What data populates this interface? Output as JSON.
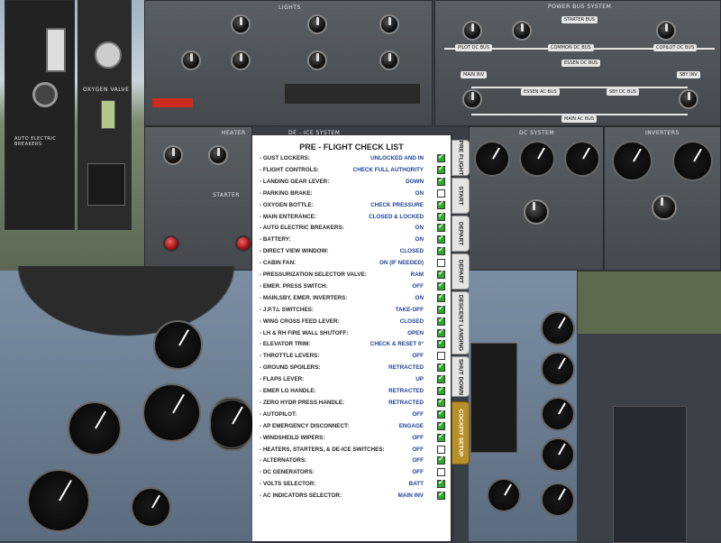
{
  "panels": {
    "lights": "LIGHTS",
    "power_bus": "POWER BUS SYSTEM",
    "heater": "HEATER",
    "deice": "DE - ICE SYSTEM",
    "dc_system": "DC SYSTEM",
    "inverters": "INVERTERS",
    "starter": "STARTER",
    "auto_breakers": "AUTO ELECTRIC BREAKERS",
    "oxygen": "OXYGEN VALVE"
  },
  "bus_labels": [
    "PILOT DC BUS",
    "COMMON DC BUS",
    "COPILOT DC BUS",
    "STARTER BUS",
    "ESSEN DC BUS",
    "MAIN INV",
    "SBY INV",
    "ESSEN AC BUS",
    "SBY DC BUS",
    "MAIN AC BUS"
  ],
  "checklist": {
    "title": "PRE - FLIGHT CHECK LIST",
    "items": [
      {
        "label": "- GUST LOCKERS:",
        "value": "UNLOCKED AND IN",
        "checked": true
      },
      {
        "label": "- FLIGHT CONTROLS:",
        "value": "CHECK FULL AUTHORITY",
        "checked": true
      },
      {
        "label": "- LANDING GEAR LEVER:",
        "value": "DOWN",
        "checked": true
      },
      {
        "label": "- PARKING BRAKE:",
        "value": "ON",
        "checked": false
      },
      {
        "label": "- OXYGEN BOTTLE:",
        "value": "CHECK PRESSURE",
        "checked": true
      },
      {
        "label": "- MAIN ENTERANCE:",
        "value": "CLOSED & LOCKED",
        "checked": true
      },
      {
        "label": "- AUTO ELECTRIC BREAKERS:",
        "value": "ON",
        "checked": true
      },
      {
        "label": "- BATTERY:",
        "value": "ON",
        "checked": true
      },
      {
        "label": "- DIRECT VIEW WINDOW:",
        "value": "CLOSED",
        "checked": true
      },
      {
        "label": "- CABIN FAN:",
        "value": "ON (IF NEEDED)",
        "checked": false
      },
      {
        "label": "- PRESSURIZATION SELECTOR VALVE:",
        "value": "RAM",
        "checked": true
      },
      {
        "label": "- EMER. PRESS SWITCH:",
        "value": "OFF",
        "checked": true
      },
      {
        "label": "- MAIN,SBY, EMER. INVERTERS:",
        "value": "ON",
        "checked": true
      },
      {
        "label": "- J.P.T.L SWITCHES:",
        "value": "TAKE-OFF",
        "checked": true
      },
      {
        "label": "- WING CROSS FEED LEVER:",
        "value": "CLOSED",
        "checked": true
      },
      {
        "label": "- LH & RH FIRE WALL SHUTOFF:",
        "value": "OPEN",
        "checked": true
      },
      {
        "label": "- ELEVATOR TRIM:",
        "value": "CHECK & RESET 0°",
        "checked": true
      },
      {
        "label": "- THROTTLE LEVERS:",
        "value": "OFF",
        "checked": false
      },
      {
        "label": "- GROUND SPOILERS:",
        "value": "RETRACTED",
        "checked": true
      },
      {
        "label": "- FLAPS  LEVER:",
        "value": "UP",
        "checked": true
      },
      {
        "label": "- EMER LG HANDLE:",
        "value": "RETRACTED",
        "checked": true
      },
      {
        "label": "- ZERO HYDR PRESS HANDLE:",
        "value": "RETRACTED",
        "checked": true
      },
      {
        "label": "- AUTOPILOT:",
        "value": "OFF",
        "checked": true
      },
      {
        "label": "- AP EMERGENCY DISCONNECT:",
        "value": "ENGAGE",
        "checked": true
      },
      {
        "label": "- WINDSHEILD WIPERS:",
        "value": "OFF",
        "checked": true
      },
      {
        "label": "- HEATERS, STARTERS, & DE-ICE SWITCHES:",
        "value": "OFF",
        "checked": false
      },
      {
        "label": "- ALTERNATORS:",
        "value": "OFF",
        "checked": true
      },
      {
        "label": "- DC GENERATORS:",
        "value": "OFF",
        "checked": false
      },
      {
        "label": "- VOLTS SELECTOR:",
        "value": "BATT",
        "checked": true
      },
      {
        "label": "- AC INDICATORS SELECTOR:",
        "value": "MAIN INV",
        "checked": true
      }
    ]
  },
  "tabs": [
    {
      "label": "PRE FLIGHT",
      "style": "light"
    },
    {
      "label": "START",
      "style": "light"
    },
    {
      "label": "DEPART",
      "style": "light"
    },
    {
      "label": "DEPART",
      "style": "light"
    },
    {
      "label": "DESCENT LANDING",
      "style": "light"
    },
    {
      "label": "SHUT DOWN",
      "style": "light"
    },
    {
      "label": "COCKPIT SETUP",
      "style": "gold"
    }
  ],
  "colors": {
    "check_green": "#2ea82e",
    "value_blue": "#1c3f96",
    "tab_gold": "#b8902a"
  }
}
